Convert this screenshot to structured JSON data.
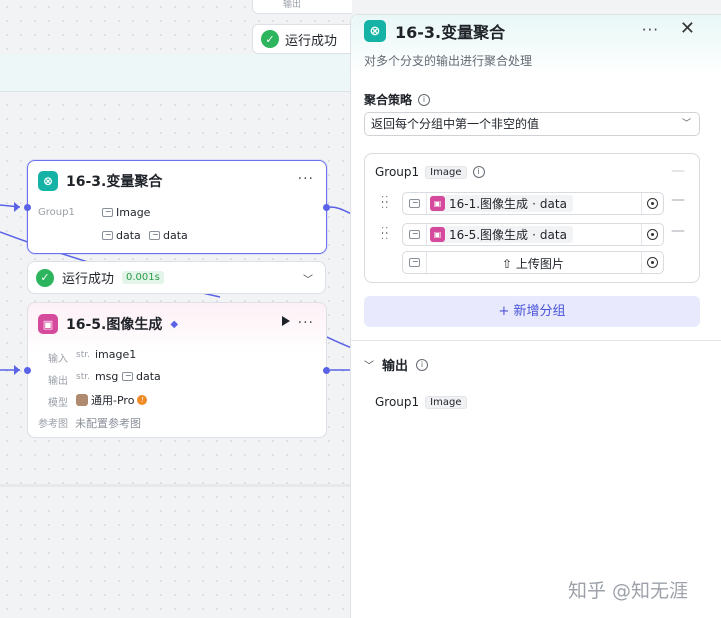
{
  "canvas": {
    "top_node_io_label": "输出",
    "top_status_text": "运行成功",
    "agg_node": {
      "title": "16-3.变量聚合",
      "group_label": "Group1",
      "tags": [
        "Image",
        "data",
        "data"
      ]
    },
    "status_node": {
      "text": "运行成功",
      "time": "0.001s"
    },
    "img_node": {
      "title": "16-5.图像生成",
      "rows": {
        "input_label": "输入",
        "input_type": "str.",
        "input_value": "image1",
        "output_label": "输出",
        "output_type": "str.",
        "output_value1": "msg",
        "output_value2": "data",
        "model_label": "模型",
        "model_value": "通用-Pro",
        "ref_label": "参考图",
        "ref_value": "未配置参考图"
      }
    }
  },
  "panel": {
    "title": "16-3.变量聚合",
    "description": "对多个分支的输出进行聚合处理",
    "strategy_label": "聚合策略",
    "strategy_value": "返回每个分组中第一个非空的值",
    "group": {
      "name": "Group1",
      "type": "Image",
      "vars": [
        {
          "node": "16-1.图像生成",
          "var": "data"
        },
        {
          "node": "16-5.图像生成",
          "var": "data"
        }
      ],
      "upload_label": "上传图片"
    },
    "add_group_label": "+ 新增分组",
    "output_label": "输出",
    "output_group": "Group1",
    "output_type": "Image"
  },
  "watermark": "知乎 @知无涯",
  "colors": {
    "accent": "#5a62e6",
    "success": "#2db55d",
    "aggregate_icon": "#14b3a6",
    "image_icon": "#d64a9e"
  }
}
